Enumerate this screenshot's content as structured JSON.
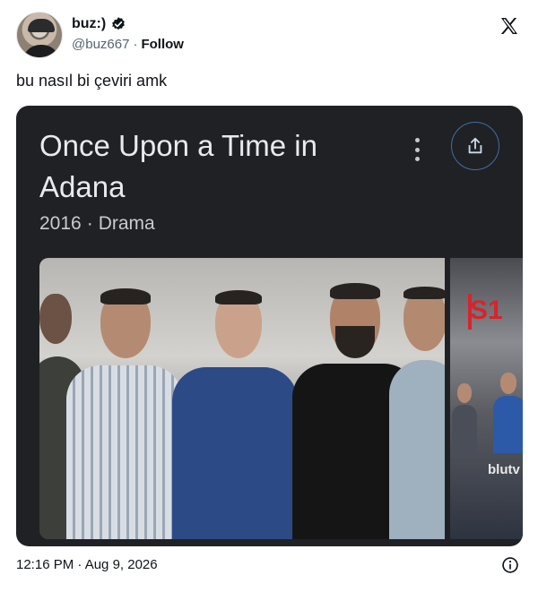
{
  "tweet": {
    "author_name": "buz:)",
    "handle": "@buz667",
    "separator": "·",
    "follow_label": "Follow",
    "text": "bu nasıl bi çeviri amk",
    "timestamp": "12:16 PM · Aug 9, 2026"
  },
  "card": {
    "title": "Once Upon a Time in Adana",
    "year": "2016",
    "meta_separator": "·",
    "genre": "Drama",
    "side_poster_title": "S1",
    "side_poster_brand": "blutv"
  },
  "icons": {
    "verified": "verified-badge-icon",
    "x_logo": "x-logo-icon",
    "kebab": "more-vertical-icon",
    "share": "share-icon",
    "info": "info-icon"
  },
  "colors": {
    "card_bg": "#202124",
    "accent_blue": "#3e6fa8",
    "poster_red": "#d5252b"
  }
}
